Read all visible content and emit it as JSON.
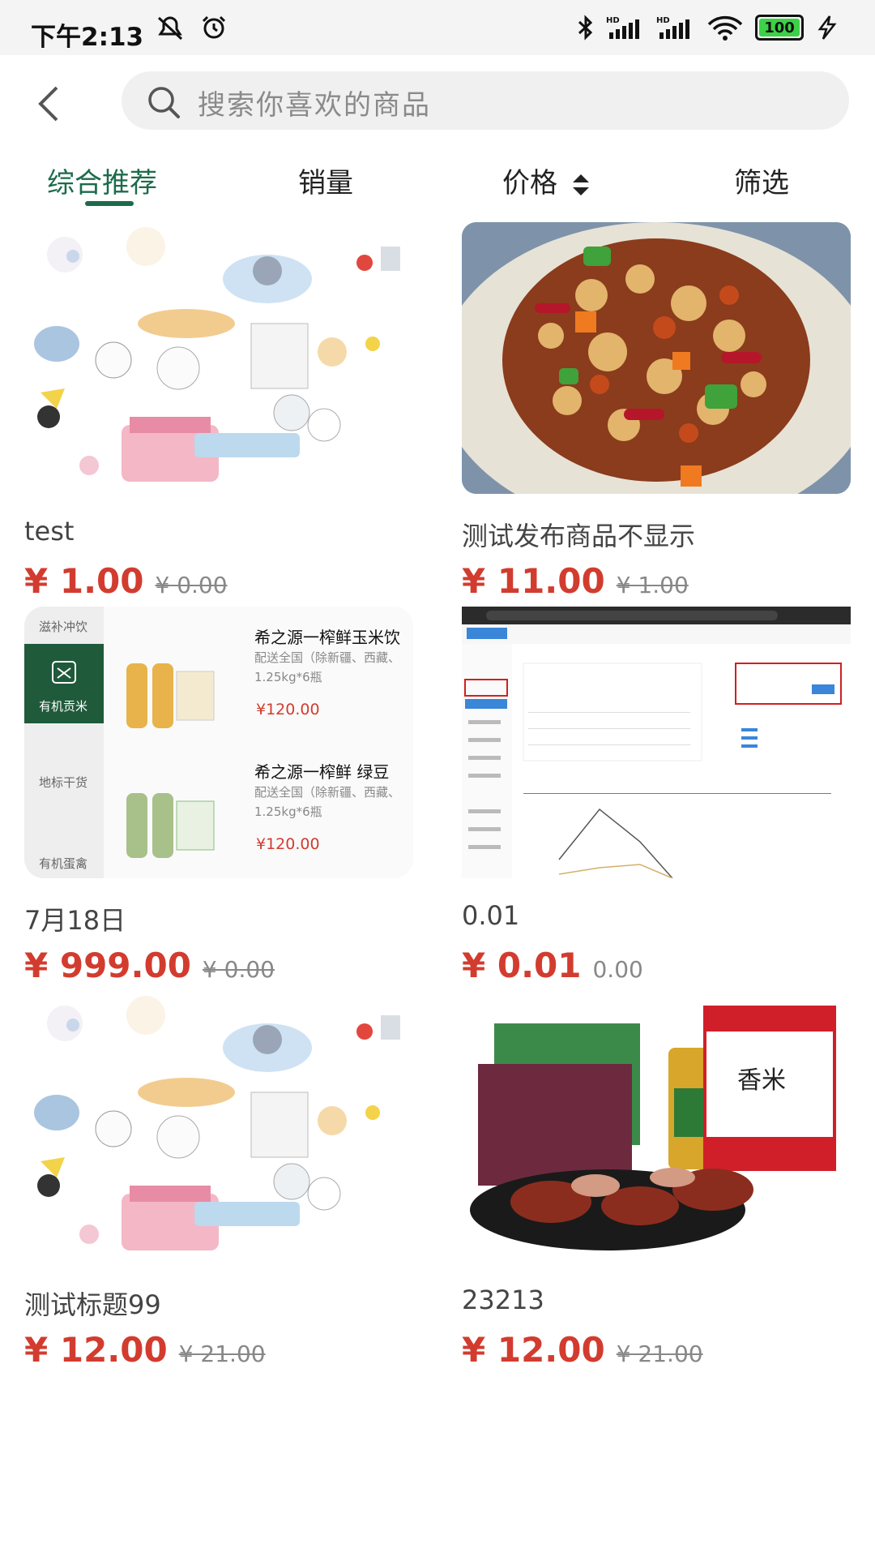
{
  "status_bar": {
    "time": "下午2:13",
    "battery": "100",
    "icons": [
      "mute-icon",
      "alarm-icon",
      "bluetooth-icon",
      "signal-hd-icon",
      "signal-hd-icon",
      "wifi-icon",
      "battery-icon",
      "charging-icon"
    ]
  },
  "header": {
    "search_placeholder": "搜索你喜欢的商品"
  },
  "sort_tabs": [
    {
      "label": "综合推荐",
      "active": true
    },
    {
      "label": "销量",
      "active": false
    },
    {
      "label": "价格",
      "active": false
    },
    {
      "label": "筛选",
      "active": false
    }
  ],
  "products": [
    {
      "title": "test",
      "price": "¥ 1.00",
      "old_price": "¥ 0.00",
      "old_strike": true,
      "image": "cartoon-illustration"
    },
    {
      "title": "测试发布商品不显示",
      "price": "¥ 11.00",
      "old_price": "¥ 1.00",
      "old_strike": true,
      "image": "kung-pao-chicken"
    },
    {
      "title": "7月18日",
      "price": "¥ 999.00",
      "old_price": "¥ 0.00",
      "old_strike": true,
      "image": "juice-product-list"
    },
    {
      "title": "0.01",
      "price": "¥ 0.01",
      "old_price": "0.00",
      "old_strike": false,
      "image": "admin-dashboard-screenshot"
    },
    {
      "title": "测试标题99",
      "price": "¥ 12.00",
      "old_price": "¥ 21.00",
      "old_strike": true,
      "image": "cartoon-illustration"
    },
    {
      "title": "23213",
      "price": "¥ 12.00",
      "old_price": "¥ 21.00",
      "old_strike": true,
      "image": "gift-box-meat-rice-oil"
    }
  ],
  "embedded_juice_list": {
    "categories": [
      "滋补冲饮",
      "有机贡米",
      "地标干货",
      "有机蛋禽"
    ],
    "items": [
      {
        "name": "希之源一榨鲜玉米饮",
        "desc": "配送全国（除新疆、西藏、",
        "spec": "1.25kg*6瓶",
        "price": "¥120.00"
      },
      {
        "name": "希之源一榨鲜 绿豆",
        "desc": "配送全国（除新疆、西藏、",
        "spec": "1.25kg*6瓶",
        "price": "¥120.00"
      }
    ]
  },
  "embedded_gift_box_text": {
    "rice_label": "香米"
  },
  "colors": {
    "accent_green": "#1c6b4a",
    "price_red": "#d23c2f",
    "search_bg": "#f0f0f0"
  }
}
